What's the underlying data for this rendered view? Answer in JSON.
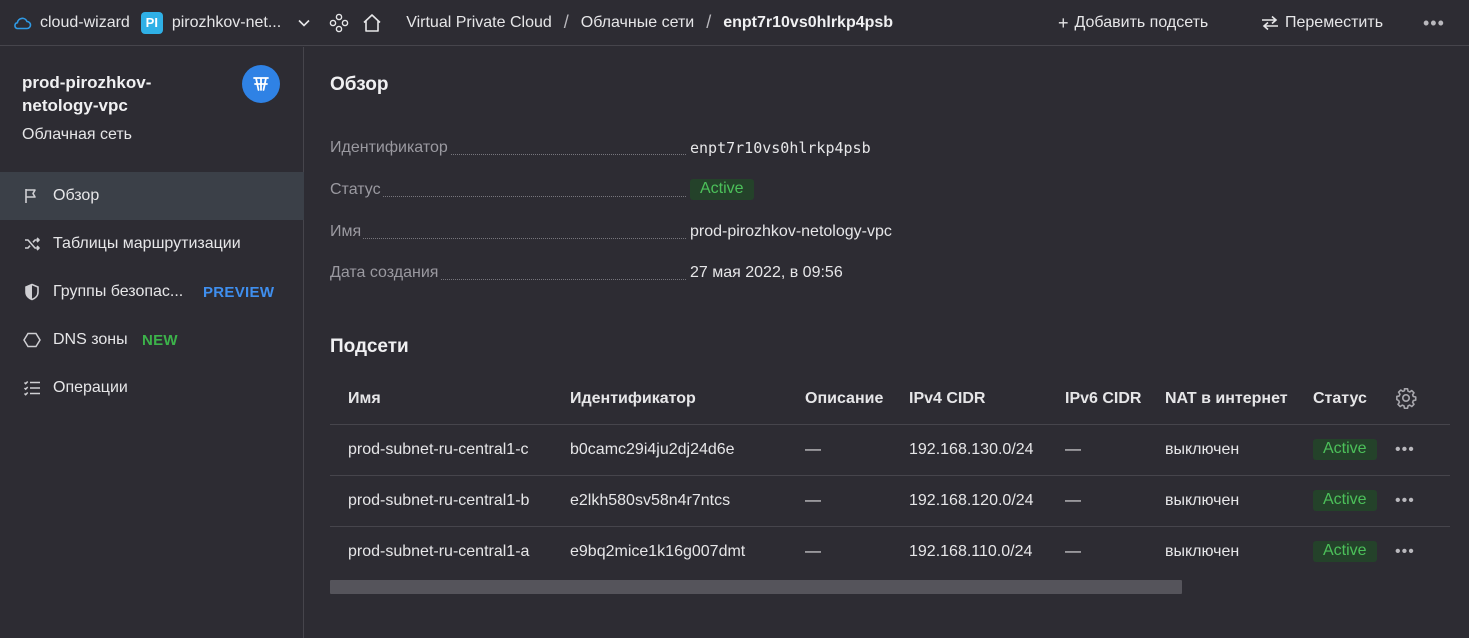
{
  "topbar": {
    "cloud_name": "cloud-wizard",
    "folder_badge": "PI",
    "folder_name": "pirozhkov-net...",
    "breadcrumbs": [
      "Virtual Private Cloud",
      "Облачные сети",
      "enpt7r10vs0hlrkp4psb"
    ],
    "separator": "/",
    "add_subnet_label": "Добавить подсеть",
    "move_label": "Переместить",
    "more_label": "•••"
  },
  "sidebar": {
    "title": "prod-pirozhkov-netology-vpc",
    "subtitle": "Облачная сеть",
    "items": [
      {
        "label": "Обзор",
        "icon": "flag-icon",
        "active": true
      },
      {
        "label": "Таблицы маршрутизации",
        "icon": "shuffle-icon"
      },
      {
        "label": "Группы безопас...",
        "icon": "shield-icon",
        "tag": "PREVIEW"
      },
      {
        "label": "DNS зоны",
        "icon": "hexagon-icon",
        "tag": "NEW"
      },
      {
        "label": "Операции",
        "icon": "list-check-icon"
      }
    ]
  },
  "overview": {
    "heading": "Обзор",
    "props": [
      {
        "label": "Идентификатор",
        "value": "enpt7r10vs0hlrkp4psb"
      },
      {
        "label": "Статус",
        "value": "Active"
      },
      {
        "label": "Имя",
        "value": "prod-pirozhkov-netology-vpc"
      },
      {
        "label": "Дата создания",
        "value": "27 мая 2022, в 09:56"
      }
    ]
  },
  "subnets": {
    "heading": "Подсети",
    "columns": [
      "Имя",
      "Идентификатор",
      "Описание",
      "IPv4 CIDR",
      "IPv6 CIDR",
      "NAT в интернет",
      "Статус"
    ],
    "rows": [
      {
        "name": "prod-subnet-ru-central1-c",
        "id": "b0camc29i4ju2dj24d6e",
        "description": "—",
        "ipv4": "192.168.130.0/24",
        "ipv6": "—",
        "nat": "выключен",
        "status": "Active"
      },
      {
        "name": "prod-subnet-ru-central1-b",
        "id": "e2lkh580sv58n4r7ntcs",
        "description": "—",
        "ipv4": "192.168.120.0/24",
        "ipv6": "—",
        "nat": "выключен",
        "status": "Active"
      },
      {
        "name": "prod-subnet-ru-central1-a",
        "id": "e9bq2mice1k16g007dmt",
        "description": "—",
        "ipv4": "192.168.110.0/24",
        "ipv6": "—",
        "nat": "выключен",
        "status": "Active"
      }
    ],
    "row_menu": "•••"
  },
  "colors": {
    "background": "#2d2c33",
    "active_badge_bg": "#24422a",
    "active_badge_text": "#4cc05a",
    "preview_tag": "#3f8fef",
    "new_tag": "#3cb24a",
    "folder_badge": "#2fb0e6",
    "avatar": "#2f82e5"
  }
}
